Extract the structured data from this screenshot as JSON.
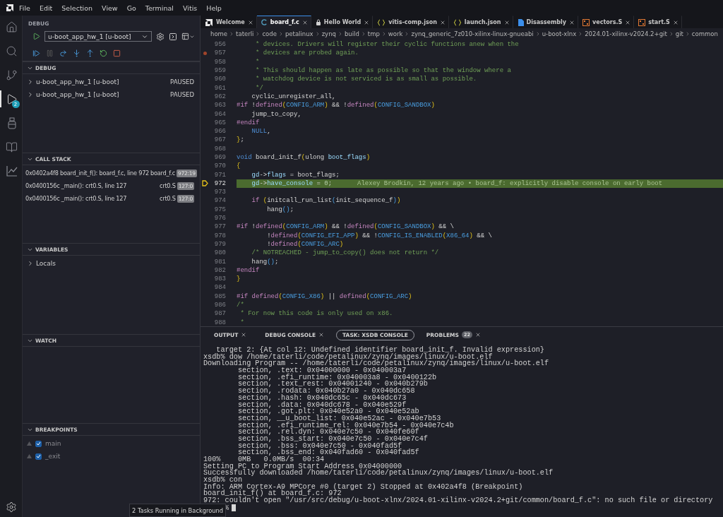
{
  "menu": [
    "File",
    "Edit",
    "Selection",
    "View",
    "Go",
    "Terminal",
    "Vitis",
    "Help"
  ],
  "activity_bar": {
    "items": [
      {
        "selected": false
      },
      {
        "selected": false
      },
      {
        "selected": false
      },
      {
        "selected": true,
        "badge": "2"
      },
      {
        "selected": false
      },
      {
        "selected": false
      },
      {
        "selected": false
      }
    ]
  },
  "sidebar": {
    "title": "DEBUG",
    "launch_config": "u-boot_app_hw_1 [u-boot]",
    "debug": {
      "header": "DEBUG",
      "sessions": [
        {
          "name": "u-boot_app_hw_1 [u-boot]",
          "status": "PAUSED",
          "expanded": false
        },
        {
          "name": "u-boot_app_hw_1 [u-boot]",
          "status": "PAUSED",
          "expanded": false
        }
      ]
    },
    "call_stack": {
      "header": "CALL STACK",
      "frames": [
        {
          "label": "0x0402a4f8 board_init_f(): board_f.c, line 972",
          "file": "board_f.c",
          "position": "972:19"
        },
        {
          "label": "0x0400156c _main(): crt0.S, line 127",
          "file": "crt0.S",
          "position": "127:0"
        },
        {
          "label": "0x0400156c _main(): crt0.S, line 127",
          "file": "crt0.S",
          "position": "127:0"
        }
      ]
    },
    "variables": {
      "header": "VARIABLES",
      "items": [
        {
          "label": "Locals",
          "expanded": false
        }
      ]
    },
    "watch": {
      "header": "WATCH"
    },
    "breakpoints": {
      "header": "BREAKPOINTS",
      "items": [
        {
          "label": "main",
          "checked": true
        },
        {
          "label": "_exit",
          "checked": true
        }
      ]
    }
  },
  "tabs": [
    {
      "label": "Welcome",
      "kind": "welcome",
      "selected": false
    },
    {
      "label": "board_f.c",
      "kind": "c",
      "selected": true
    },
    {
      "label": "Hello World",
      "kind": "preview",
      "selected": false
    },
    {
      "label": "vitis-comp.json",
      "kind": "json",
      "selected": false
    },
    {
      "label": "launch.json",
      "kind": "json",
      "selected": false
    },
    {
      "label": "Disassembly",
      "kind": "disassembly",
      "selected": false
    },
    {
      "label": "vectors.S",
      "kind": "asm",
      "selected": false
    },
    {
      "label": "start.S",
      "kind": "asm",
      "selected": false
    }
  ],
  "breadcrumb": [
    "home",
    "taterli",
    "code",
    "petalinux",
    "zynq",
    "build",
    "tmp",
    "work",
    "zynq_generic_7z010-xilinx-linux-gnueabi",
    "u-boot-xlnx",
    "2024.01-xilinx-v2024.2+git",
    "git",
    "common"
  ],
  "code": [
    {
      "number": "956",
      "tokens": [
        {
          "text": "     * devices. Drivers will register their cyclic functions anew when the",
          "kind": "comment"
        }
      ]
    },
    {
      "number": "957",
      "breakpoint": true,
      "tokens": [
        {
          "text": "     * devices are probed again.",
          "kind": "comment"
        }
      ]
    },
    {
      "number": "958",
      "tokens": [
        {
          "text": "     *",
          "kind": "comment"
        }
      ]
    },
    {
      "number": "959",
      "tokens": [
        {
          "text": "     * This should happen as late as possible so that the window where a",
          "kind": "comment"
        }
      ]
    },
    {
      "number": "960",
      "tokens": [
        {
          "text": "     * watchdog device is not serviced is as small as possible.",
          "kind": "comment"
        }
      ]
    },
    {
      "number": "961",
      "tokens": [
        {
          "text": "     */",
          "kind": "comment"
        }
      ]
    },
    {
      "number": "962",
      "tokens": [
        {
          "text": "    cyclic_unregister_all,",
          "kind": "plain"
        }
      ]
    },
    {
      "number": "963",
      "tokens": [
        {
          "text": "#if",
          "kind": "preproc"
        },
        {
          "text": " !",
          "kind": "plain"
        },
        {
          "text": "defined",
          "kind": "func"
        },
        {
          "text": "(",
          "kind": "bracket"
        },
        {
          "text": "CONFIG_ARM",
          "kind": "macro"
        },
        {
          "text": ")",
          "kind": "bracket"
        },
        {
          "text": " && !",
          "kind": "plain"
        },
        {
          "text": "defined",
          "kind": "func"
        },
        {
          "text": "(",
          "kind": "bracket"
        },
        {
          "text": "CONFIG_SANDBOX",
          "kind": "macro"
        },
        {
          "text": ")",
          "kind": "bracket"
        }
      ]
    },
    {
      "number": "964",
      "tokens": [
        {
          "text": "    jump_to_copy,",
          "kind": "plain"
        }
      ]
    },
    {
      "number": "965",
      "tokens": [
        {
          "text": "#endif",
          "kind": "preproc"
        }
      ]
    },
    {
      "number": "966",
      "tokens": [
        {
          "text": "    NULL",
          "kind": "keyword"
        },
        {
          "text": ",",
          "kind": "plain"
        }
      ]
    },
    {
      "number": "967",
      "tokens": [
        {
          "text": "}",
          "kind": "bracket"
        },
        {
          "text": ";",
          "kind": "plain"
        }
      ]
    },
    {
      "number": "968"
    },
    {
      "number": "969",
      "tokens": [
        {
          "text": "void",
          "kind": "keyword"
        },
        {
          "text": " board_init_f",
          "kind": "plain"
        },
        {
          "text": "(",
          "kind": "bracket"
        },
        {
          "text": "ulong ",
          "kind": "plain"
        },
        {
          "text": "boot_flags",
          "kind": "var"
        },
        {
          "text": ")",
          "kind": "bracket"
        }
      ]
    },
    {
      "number": "970",
      "tokens": [
        {
          "text": "{",
          "kind": "bracket"
        }
      ]
    },
    {
      "number": "971",
      "tokens": [
        {
          "text": "    gd",
          "kind": "var"
        },
        {
          "text": "->",
          "kind": "plain"
        },
        {
          "text": "flags",
          "kind": "var"
        },
        {
          "text": " = boot_flags;",
          "kind": "plain"
        }
      ]
    },
    {
      "number": "972",
      "current": true,
      "blame": "Alexey Brodkin, 12 years ago • board_f: explicitly disable console on early boot",
      "tokens": [
        {
          "text": "    gd",
          "kind": "var"
        },
        {
          "text": "->",
          "kind": "plain"
        },
        {
          "text": "have_console",
          "kind": "var"
        },
        {
          "text": " = ",
          "kind": "plain"
        },
        {
          "text": "0",
          "kind": "number"
        },
        {
          "text": ";",
          "kind": "plain"
        }
      ]
    },
    {
      "number": "973"
    },
    {
      "number": "974",
      "tokens": [
        {
          "text": "    if ",
          "kind": "control"
        },
        {
          "text": "(",
          "kind": "bracket"
        },
        {
          "text": "initcall_run_list",
          "kind": "plain"
        },
        {
          "text": "(",
          "kind": "bracket2"
        },
        {
          "text": "init_sequence_f",
          "kind": "plain"
        },
        {
          "text": ")",
          "kind": "bracket2"
        },
        {
          "text": ")",
          "kind": "bracket"
        }
      ]
    },
    {
      "number": "975",
      "tokens": [
        {
          "text": "        hang",
          "kind": "plain"
        },
        {
          "text": "()",
          "kind": "bracket2"
        },
        {
          "text": ";",
          "kind": "plain"
        }
      ]
    },
    {
      "number": "976"
    },
    {
      "number": "977",
      "tokens": [
        {
          "text": "#if",
          "kind": "preproc"
        },
        {
          "text": " !",
          "kind": "plain"
        },
        {
          "text": "defined",
          "kind": "func"
        },
        {
          "text": "(",
          "kind": "bracket"
        },
        {
          "text": "CONFIG_ARM",
          "kind": "macro"
        },
        {
          "text": ")",
          "kind": "bracket"
        },
        {
          "text": " && !",
          "kind": "plain"
        },
        {
          "text": "defined",
          "kind": "func"
        },
        {
          "text": "(",
          "kind": "bracket"
        },
        {
          "text": "CONFIG_SANDBOX",
          "kind": "macro"
        },
        {
          "text": ")",
          "kind": "bracket"
        },
        {
          "text": " && \\",
          "kind": "plain"
        }
      ]
    },
    {
      "number": "978",
      "tokens": [
        {
          "text": "        !",
          "kind": "plain"
        },
        {
          "text": "defined",
          "kind": "func"
        },
        {
          "text": "(",
          "kind": "bracket"
        },
        {
          "text": "CONFIG_EFI_APP",
          "kind": "macro"
        },
        {
          "text": ")",
          "kind": "bracket"
        },
        {
          "text": " && !",
          "kind": "plain"
        },
        {
          "text": "CONFIG_IS_ENABLED",
          "kind": "macro"
        },
        {
          "text": "(",
          "kind": "bracket"
        },
        {
          "text": "X86_64",
          "kind": "macro"
        },
        {
          "text": ")",
          "kind": "bracket"
        },
        {
          "text": " && \\",
          "kind": "plain"
        }
      ]
    },
    {
      "number": "979",
      "tokens": [
        {
          "text": "        !",
          "kind": "plain"
        },
        {
          "text": "defined",
          "kind": "func"
        },
        {
          "text": "(",
          "kind": "bracket"
        },
        {
          "text": "CONFIG_ARC",
          "kind": "macro"
        },
        {
          "text": ")",
          "kind": "bracket"
        }
      ]
    },
    {
      "number": "980",
      "tokens": [
        {
          "text": "    /* NOTREACHED - jump_to_copy() does not return */",
          "kind": "comment"
        }
      ]
    },
    {
      "number": "981",
      "tokens": [
        {
          "text": "    hang",
          "kind": "plain"
        },
        {
          "text": "()",
          "kind": "bracket2"
        },
        {
          "text": ";",
          "kind": "plain"
        }
      ]
    },
    {
      "number": "982",
      "tokens": [
        {
          "text": "#endif",
          "kind": "preproc"
        }
      ]
    },
    {
      "number": "983",
      "tokens": [
        {
          "text": "}",
          "kind": "bracket"
        }
      ]
    },
    {
      "number": "984"
    },
    {
      "number": "985",
      "tokens": [
        {
          "text": "#if ",
          "kind": "preproc"
        },
        {
          "text": "defined",
          "kind": "func"
        },
        {
          "text": "(",
          "kind": "bracket"
        },
        {
          "text": "CONFIG_X86",
          "kind": "macro"
        },
        {
          "text": ")",
          "kind": "bracket"
        },
        {
          "text": " || ",
          "kind": "plain"
        },
        {
          "text": "defined",
          "kind": "func"
        },
        {
          "text": "(",
          "kind": "bracket"
        },
        {
          "text": "CONFIG_ARC",
          "kind": "macro"
        },
        {
          "text": ")",
          "kind": "bracket"
        }
      ]
    },
    {
      "number": "986",
      "tokens": [
        {
          "text": "/*",
          "kind": "comment"
        }
      ]
    },
    {
      "number": "987",
      "tokens": [
        {
          "text": " * For now this code is only used on x86.",
          "kind": "comment"
        }
      ]
    },
    {
      "number": "988",
      "tokens": [
        {
          "text": " *",
          "kind": "comment"
        }
      ]
    }
  ],
  "panel": {
    "tabs": [
      {
        "label": "OUTPUT",
        "selected": false
      },
      {
        "label": "DEBUG CONSOLE",
        "selected": false
      },
      {
        "label": "TASK: XSDB CONSOLE",
        "selected": true
      },
      {
        "label": "PROBLEMS",
        "selected": false,
        "badge": "22"
      }
    ],
    "terminal": {
      "lines": [
        "   target 2: {At col 12: Undefined identifier board_init_f. Invalid expression}",
        "xsdb% dow /home/taterli/code/petalinux/zynq/images/linux/u-boot.elf",
        "Downloading Program -- /home/taterli/code/petalinux/zynq/images/linux/u-boot.elf",
        "\tsection, .text: 0x04000000 - 0x040003a7",
        "\tsection, .efi_runtime: 0x040003a8 - 0x0400122b",
        "\tsection, .text_rest: 0x04001240 - 0x040b279b",
        "\tsection, .rodata: 0x040b27a0 - 0x040dc658",
        "\tsection, .hash: 0x040dc65c - 0x040dc673",
        "\tsection, .data: 0x040dc678 - 0x040e529f",
        "\tsection, .got.plt: 0x040e52a0 - 0x040e52ab",
        "\tsection, __u_boot_list: 0x040e52ac - 0x040e7b53",
        "\tsection, .efi_runtime_rel: 0x040e7b54 - 0x040e7c4b",
        "\tsection, .rel.dyn: 0x040e7c50 - 0x040fe60f",
        "\tsection, .bss_start: 0x040e7c50 - 0x040e7c4f",
        "\tsection, .bss: 0x040e7c50 - 0x040fad5f",
        "\tsection, .bss_end: 0x040fad60 - 0x040fad5f",
        "100%    0MB   0.0MB/s  00:34",
        "Setting PC to Program Start Address 0x04000000",
        "Successfully downloaded /home/taterli/code/petalinux/zynq/images/linux/u-boot.elf",
        "xsdb% con",
        "Info: ARM Cortex-A9 MPCore #0 (target 2) Stopped at 0x402a4f8 (Breakpoint)",
        "board_init_f() at board_f.c: 972",
        "972: couldn't open \"/usr/src/debug/u-boot-xlnx/2024.01-xilinx-v2024.2+git/common/board_f.c\": no such file or directory"
      ],
      "prompt": "%"
    }
  },
  "notification": "2 Tasks Running in Background"
}
